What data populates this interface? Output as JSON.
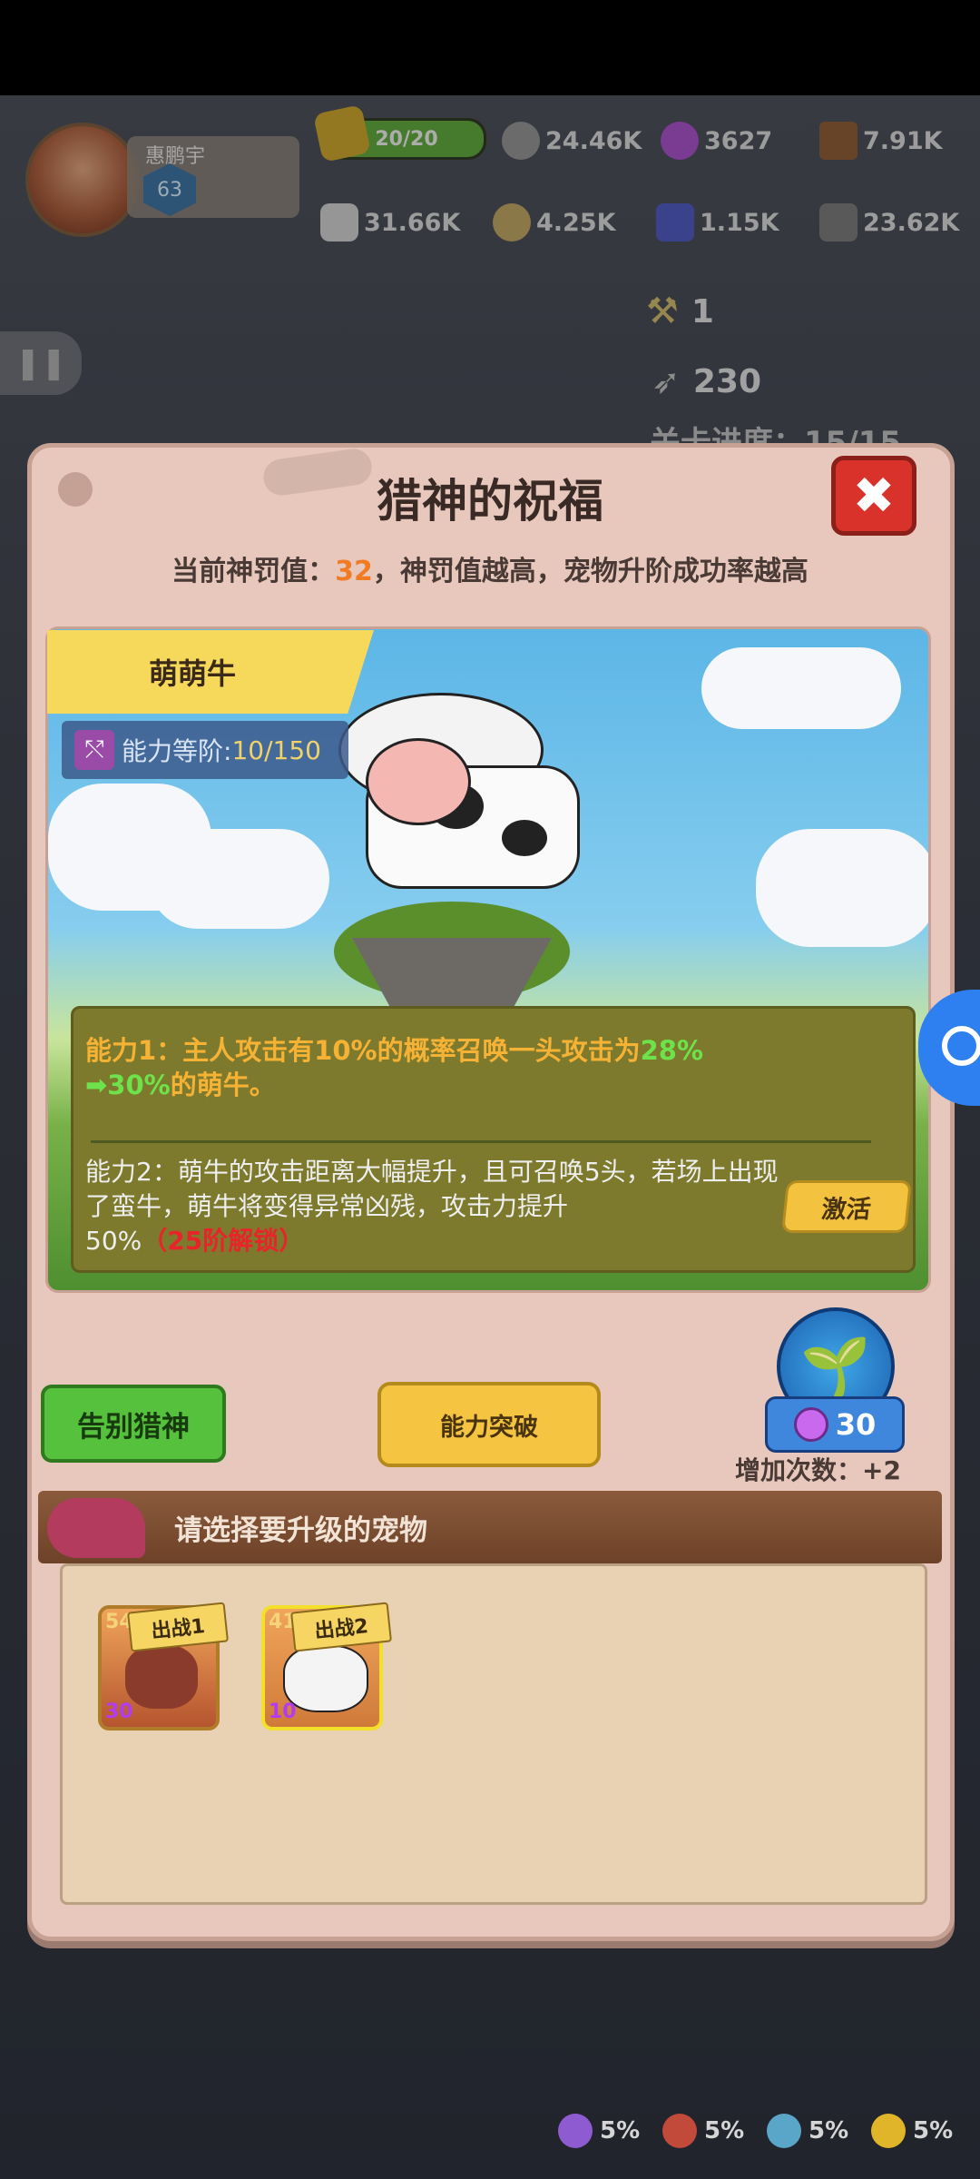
{
  "hud": {
    "username": "惠鹏宇",
    "level": "63",
    "energy_text": "20/20",
    "energy_fraction": 1.0,
    "resources": [
      {
        "icon": "stone-icon",
        "value": "24.46K"
      },
      {
        "icon": "gem-icon",
        "value": "3627"
      },
      {
        "icon": "wood-icon",
        "value": "7.91K"
      },
      {
        "icon": "bone-icon",
        "value": "31.66K"
      },
      {
        "icon": "ore-icon",
        "value": "4.25K"
      },
      {
        "icon": "crystal-icon",
        "value": "1.15K"
      },
      {
        "icon": "rock-icon",
        "value": "23.62K"
      }
    ]
  },
  "scene": {
    "pickaxe_count": "1",
    "feather_count": "230",
    "stage_progress": "关卡进度：15/15"
  },
  "panel": {
    "title": "猎神的祝福",
    "subtitle_prefix": "当前神罚值：",
    "subtitle_value": "32",
    "subtitle_suffix": "，神罚值越高，宠物升阶成功率越高",
    "close_icon": "close-icon"
  },
  "pet": {
    "name": "萌萌牛",
    "tier_label": "能力等阶:",
    "tier_value": "10/150"
  },
  "abilities": {
    "ability1_a": "能力1：主人攻击有10%的概率召唤一头攻击为",
    "ability1_green": "28%",
    "ability1_arrow": "➡30%",
    "ability1_b": "的萌牛。",
    "ability2_text": "能力2：萌牛的攻击距离大幅提升，且可召唤5头，若场上出现了蛮牛，萌牛将变得异常凶残，攻击力提升50%",
    "ability2_lock": "（25阶解锁）",
    "activate_label": "激活"
  },
  "actions": {
    "farewell_label": "告别猎神",
    "breakthrough_label": "能力突破",
    "cost": "30",
    "extra_count": "增加次数：+2"
  },
  "selection": {
    "banner": "请选择要升级的宠物",
    "pets": [
      {
        "level": "54",
        "deploy": "出战1",
        "stars": "30"
      },
      {
        "level": "41",
        "deploy": "出战2",
        "stars": "10"
      }
    ]
  },
  "bottom_stats": [
    {
      "icon": "moon-icon",
      "value": "5%"
    },
    {
      "icon": "flame-icon",
      "value": "5%"
    },
    {
      "icon": "wave-icon",
      "value": "5%"
    },
    {
      "icon": "lightning-icon",
      "value": "5%"
    }
  ],
  "colors": {
    "accent_orange": "#f07b22",
    "green_text": "#6de24a",
    "red_lock": "#e8242a",
    "panel_bg": "#e8c8bd"
  }
}
